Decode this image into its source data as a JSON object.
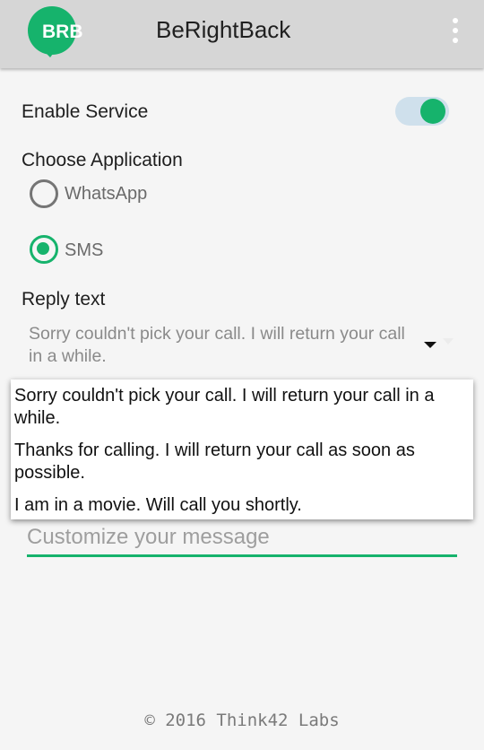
{
  "app_bar": {
    "title": "BeRightBack",
    "logo_text": "BRB",
    "brand_color": "#16b36c",
    "menu_icon": "more-vert-icon"
  },
  "settings": {
    "enable_service": {
      "label": "Enable Service",
      "enabled": true
    },
    "choose_application": {
      "label": "Choose Application",
      "options": [
        {
          "label": "WhatsApp",
          "checked": false
        },
        {
          "label": "SMS",
          "checked": true
        }
      ]
    },
    "reply_text": {
      "label": "Reply text",
      "selected": "Sorry couldn't pick your call. I will return your call in a while.",
      "dropdown_options": [
        "Sorry couldn't pick your call. I will return your call in a while.",
        "Thanks for calling. I will return your call as soon as possible.",
        "I am in a movie. Will call you shortly."
      ]
    },
    "custom_message": {
      "placeholder": "Customize your message",
      "value": ""
    }
  },
  "footer": {
    "text": "© 2016 Think42 Labs"
  }
}
